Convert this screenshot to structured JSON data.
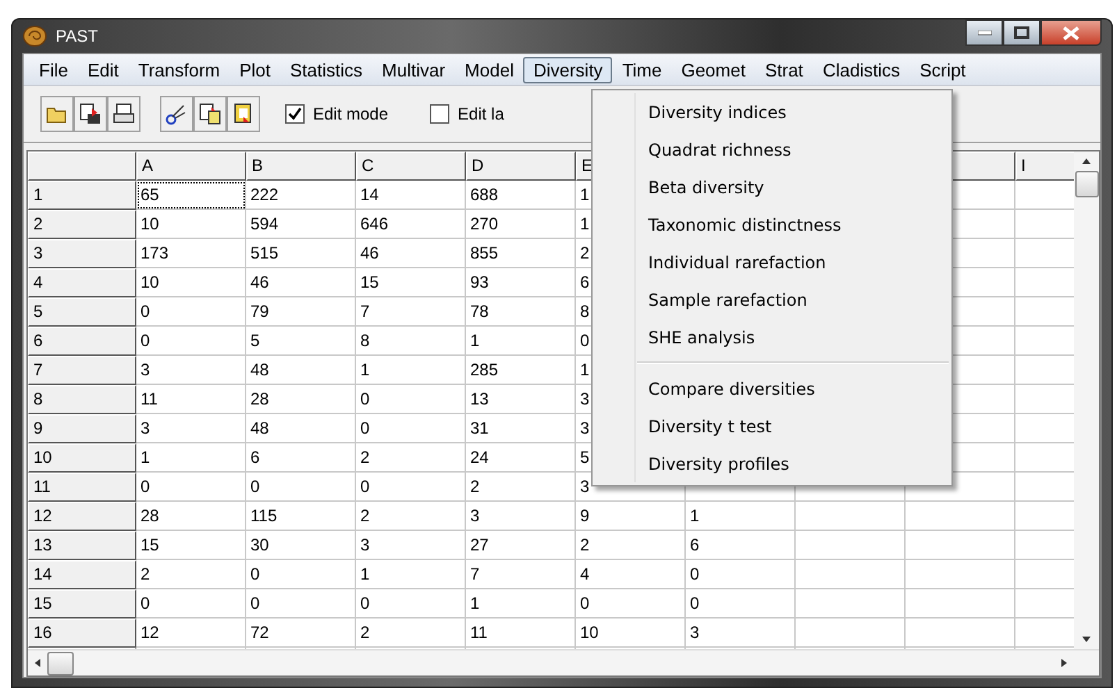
{
  "window": {
    "title": "PAST"
  },
  "menu_bar": [
    {
      "label": "File",
      "selected": false
    },
    {
      "label": "Edit",
      "selected": false
    },
    {
      "label": "Transform",
      "selected": false
    },
    {
      "label": "Plot",
      "selected": false
    },
    {
      "label": "Statistics",
      "selected": false
    },
    {
      "label": "Multivar",
      "selected": false
    },
    {
      "label": "Model",
      "selected": false
    },
    {
      "label": "Diversity",
      "selected": true
    },
    {
      "label": "Time",
      "selected": false
    },
    {
      "label": "Geomet",
      "selected": false
    },
    {
      "label": "Strat",
      "selected": false
    },
    {
      "label": "Cladistics",
      "selected": false
    },
    {
      "label": "Script",
      "selected": false
    }
  ],
  "toolbar": {
    "checkboxes": [
      {
        "label": "Edit mode",
        "checked": true
      },
      {
        "label": "Edit la",
        "checked": false
      }
    ]
  },
  "table": {
    "columns": [
      "A",
      "B",
      "C",
      "D",
      "E",
      "",
      "",
      "",
      "I"
    ],
    "rows": [
      {
        "header": "1",
        "cells": [
          "65",
          "222",
          "14",
          "688",
          "1"
        ]
      },
      {
        "header": "2",
        "cells": [
          "10",
          "594",
          "646",
          "270",
          "1"
        ]
      },
      {
        "header": "3",
        "cells": [
          "173",
          "515",
          "46",
          "855",
          "2"
        ]
      },
      {
        "header": "4",
        "cells": [
          "10",
          "46",
          "15",
          "93",
          "6"
        ]
      },
      {
        "header": "5",
        "cells": [
          "0",
          "79",
          "7",
          "78",
          "8"
        ]
      },
      {
        "header": "6",
        "cells": [
          "0",
          "5",
          "8",
          "1",
          "0"
        ]
      },
      {
        "header": "7",
        "cells": [
          "3",
          "48",
          "1",
          "285",
          "1"
        ]
      },
      {
        "header": "8",
        "cells": [
          "11",
          "28",
          "0",
          "13",
          "3"
        ]
      },
      {
        "header": "9",
        "cells": [
          "3",
          "48",
          "0",
          "31",
          "3"
        ]
      },
      {
        "header": "10",
        "cells": [
          "1",
          "6",
          "2",
          "24",
          "5"
        ]
      },
      {
        "header": "11",
        "cells": [
          "0",
          "0",
          "0",
          "2",
          "3"
        ]
      },
      {
        "header": "12",
        "cells": [
          "28",
          "115",
          "2",
          "3",
          "9",
          "1"
        ]
      },
      {
        "header": "13",
        "cells": [
          "15",
          "30",
          "3",
          "27",
          "2",
          "6"
        ]
      },
      {
        "header": "14",
        "cells": [
          "2",
          "0",
          "1",
          "7",
          "4",
          "0"
        ]
      },
      {
        "header": "15",
        "cells": [
          "0",
          "0",
          "0",
          "1",
          "0",
          "0"
        ]
      },
      {
        "header": "16",
        "cells": [
          "12",
          "72",
          "2",
          "11",
          "10",
          "3"
        ]
      }
    ]
  },
  "dropdown_menu": {
    "items": [
      {
        "label": "Diversity indices",
        "kind": "item"
      },
      {
        "label": "Quadrat richness",
        "kind": "item"
      },
      {
        "label": "Beta diversity",
        "kind": "item"
      },
      {
        "label": "Taxonomic distinctness",
        "kind": "item"
      },
      {
        "label": "Individual rarefaction",
        "kind": "item"
      },
      {
        "label": "Sample rarefaction",
        "kind": "item"
      },
      {
        "label": "SHE analysis",
        "kind": "item"
      },
      {
        "kind": "separator"
      },
      {
        "label": "Compare diversities",
        "kind": "item"
      },
      {
        "label": "Diversity t test",
        "kind": "item"
      },
      {
        "label": "Diversity profiles",
        "kind": "item"
      }
    ]
  }
}
